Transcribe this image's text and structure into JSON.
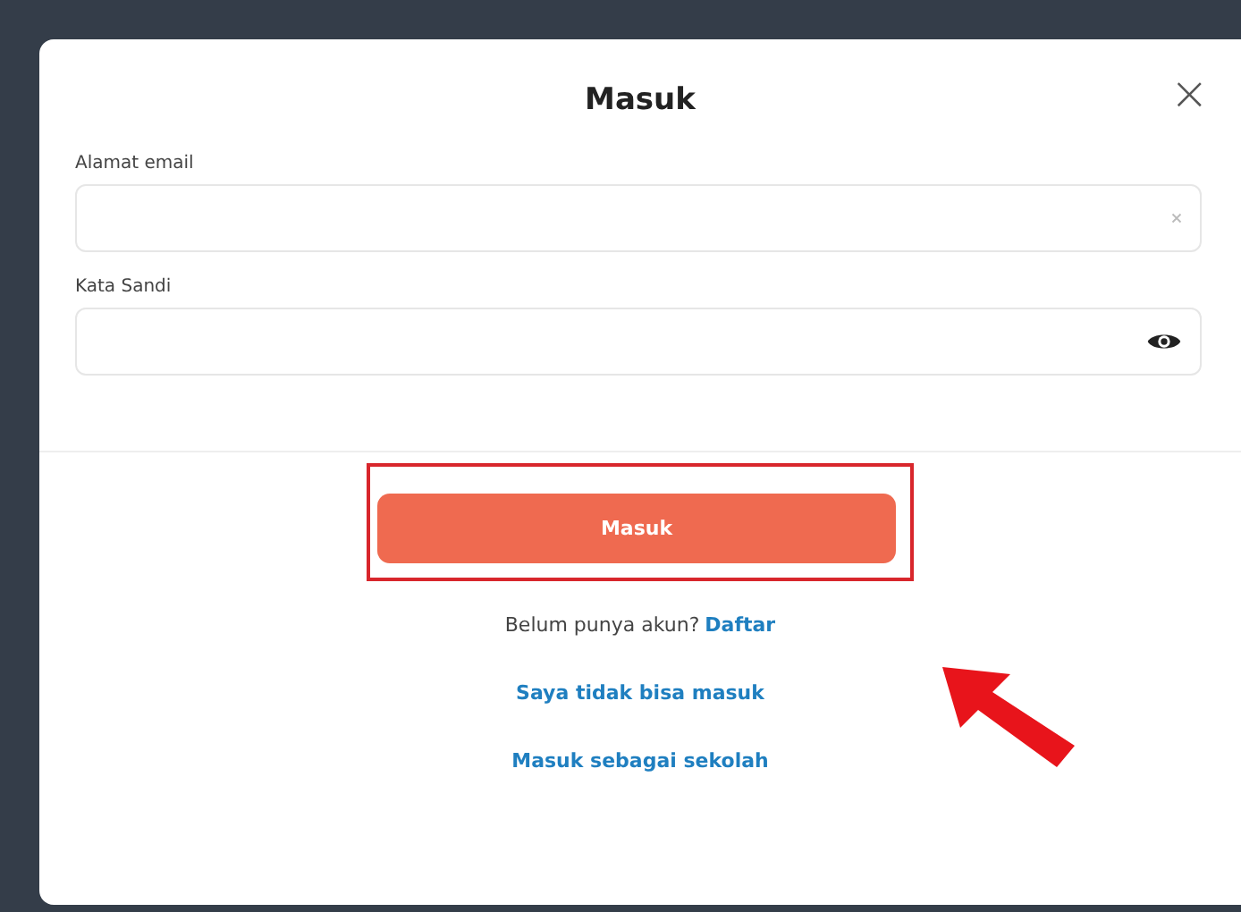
{
  "dialog": {
    "title": "Masuk",
    "close": "×"
  },
  "fields": [
    {
      "label": "Alamat email",
      "kind": "clear"
    },
    {
      "label": "Kata Sandi",
      "kind": "reveal"
    }
  ],
  "submit": {
    "label": "Masuk",
    "highlighted": true
  },
  "signup": {
    "text": "Belum punya akun?",
    "link": "Daftar"
  },
  "links": [
    "Saya tidak bisa masuk",
    "Masuk sebagai sekolah"
  ]
}
